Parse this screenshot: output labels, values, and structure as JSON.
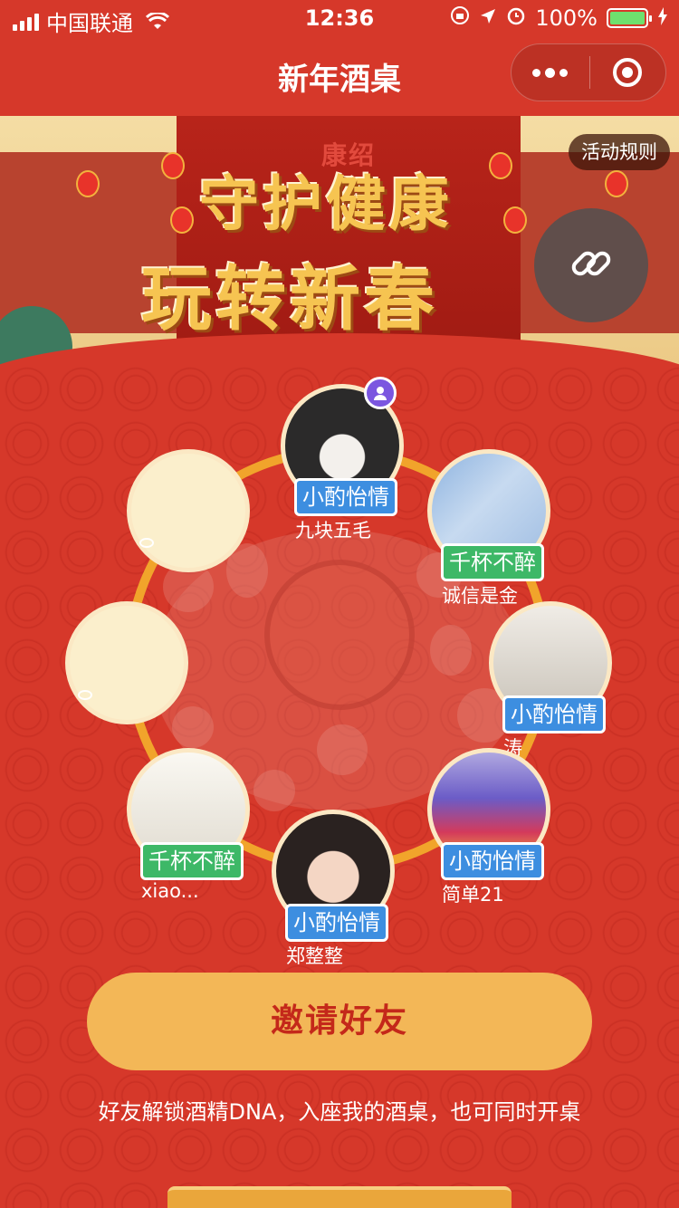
{
  "status_bar": {
    "carrier": "中国联通",
    "time": "12:36",
    "battery": "100%"
  },
  "nav": {
    "title": "新年酒桌"
  },
  "banner": {
    "brand": "康绍",
    "slogan_line1": "守护健康",
    "slogan_line2": "玩转新春",
    "rules_label": "活动规则"
  },
  "seats": [
    {
      "name": "九块五毛",
      "tag": "小酌怡情",
      "tag_color": "#3d8ee0",
      "host": true
    },
    {
      "name": "诚信是金",
      "tag": "千杯不醉",
      "tag_color": "#3db867"
    },
    {
      "name": "涛",
      "tag": "小酌怡情",
      "tag_color": "#3d8ee0"
    },
    {
      "name": "简单21",
      "tag": "小酌怡情",
      "tag_color": "#3d8ee0"
    },
    {
      "name": "郑整整",
      "tag": "小酌怡情",
      "tag_color": "#3d8ee0"
    },
    {
      "name": "xiao...",
      "tag": "千杯不醉",
      "tag_color": "#3db867"
    }
  ],
  "invite": {
    "button_label": "邀请好友",
    "hint": "好友解锁酒精DNA，入座我的酒桌，也可同时开桌"
  },
  "colors": {
    "background": "#d6382a",
    "ring": "#f1a42b",
    "invite_button": "#f3b757",
    "invite_text": "#c4281a"
  }
}
